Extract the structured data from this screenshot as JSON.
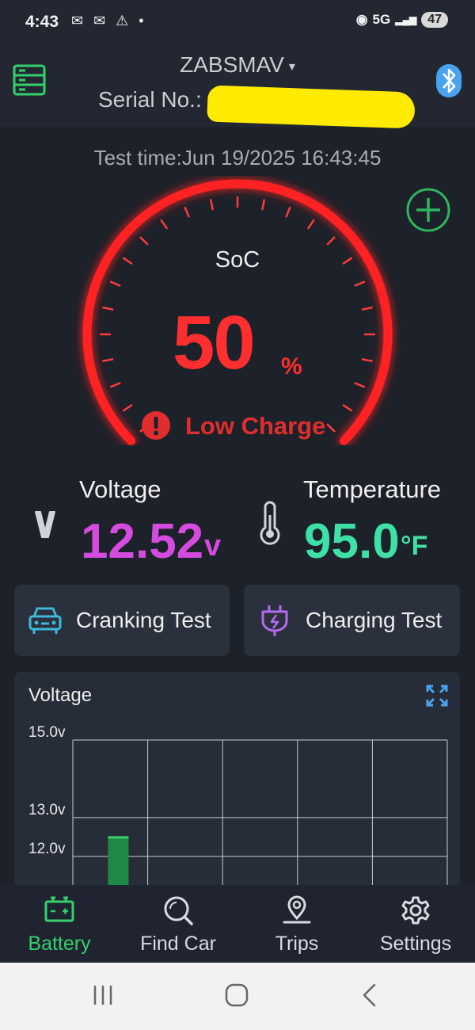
{
  "status_bar": {
    "time": "4:43",
    "icons": "✉ ✉ ⚠ •",
    "network": "5G",
    "battery": "47"
  },
  "header": {
    "device_name": "ZABSMAV",
    "caret": "▾",
    "serial_label": "Serial No.:"
  },
  "main": {
    "test_time": "Test time:Jun 19/2025 16:43:45",
    "soc_label": "SoC",
    "soc_value": "50",
    "soc_unit": "%",
    "soc_fraction": 0.5,
    "status_text": "Low Charge",
    "accent_color": "#ff2f2f"
  },
  "metrics": {
    "voltage_label": "Voltage",
    "voltage_value": "12.52",
    "voltage_unit": "v",
    "temperature_label": "Temperature",
    "temperature_value": "95.0",
    "temperature_unit": "°F"
  },
  "tests": {
    "cranking_label": "Cranking Test",
    "charging_label": "Charging Test"
  },
  "chart_data": {
    "type": "bar",
    "title": "Voltage",
    "y_ticks": [
      "15.0v",
      "13.0v",
      "12.0v"
    ],
    "values": [
      12.52
    ],
    "ylim": [
      11.2,
      15.0
    ],
    "grid": true,
    "bar_color": "#1f8a45"
  },
  "bottom_nav": {
    "items": [
      {
        "label": "Battery",
        "icon": "battery-icon",
        "active": true
      },
      {
        "label": "Find Car",
        "icon": "search-icon",
        "active": false
      },
      {
        "label": "Trips",
        "icon": "location-pin-icon",
        "active": false
      },
      {
        "label": "Settings",
        "icon": "gear-icon",
        "active": false
      }
    ]
  }
}
